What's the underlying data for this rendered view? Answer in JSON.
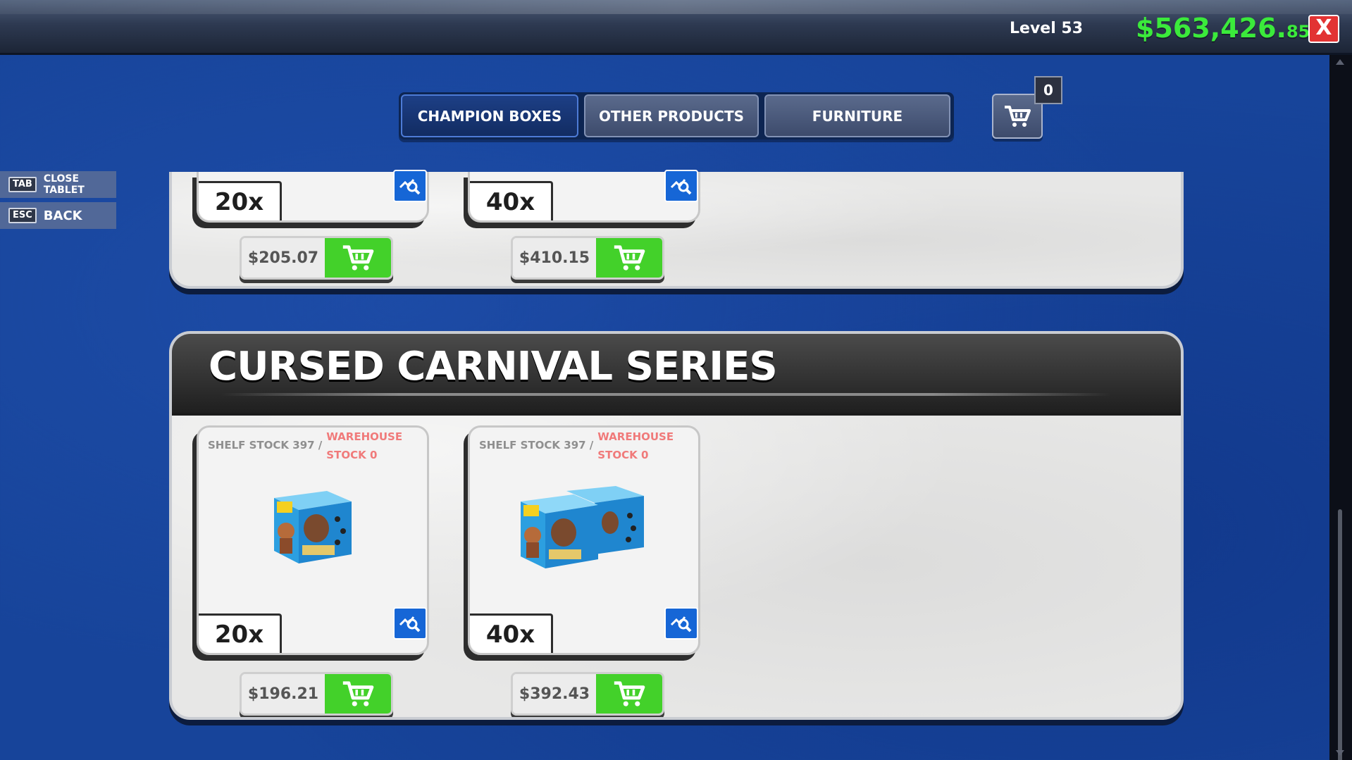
{
  "header": {
    "level": "Level 53",
    "money_main": "$563,426.",
    "money_cents": "85",
    "close_label": "X"
  },
  "tabs": [
    {
      "label": "CHAMPION BOXES",
      "active": true
    },
    {
      "label": "OTHER PRODUCTS",
      "active": false
    },
    {
      "label": "FURNITURE",
      "active": false
    }
  ],
  "cart": {
    "count": "0",
    "icon": "cart-icon"
  },
  "hints": [
    {
      "key": "TAB",
      "label": "CLOSE TABLET"
    },
    {
      "key": "ESC",
      "label": "BACK"
    }
  ],
  "previous_series": {
    "products": [
      {
        "quantity": "20x",
        "price": "$205.07"
      },
      {
        "quantity": "40x",
        "price": "$410.15"
      }
    ]
  },
  "cursed_series": {
    "title": "CURSED CARNIVAL SERIES",
    "products": [
      {
        "shelf_stock": "SHELF STOCK 397 /",
        "warehouse_stock": "WAREHOUSE STOCK 0",
        "quantity": "20x",
        "price": "$196.21"
      },
      {
        "shelf_stock": "SHELF STOCK 397 /",
        "warehouse_stock": "WAREHOUSE STOCK 0",
        "quantity": "40x",
        "price": "$392.43"
      }
    ]
  },
  "colors": {
    "background": "#17449a",
    "money": "#3bea3b",
    "buy_button": "#43d12a",
    "zoom_button": "#1666d6",
    "warehouse_text": "#f07a7a",
    "close_button": "#e23333"
  }
}
